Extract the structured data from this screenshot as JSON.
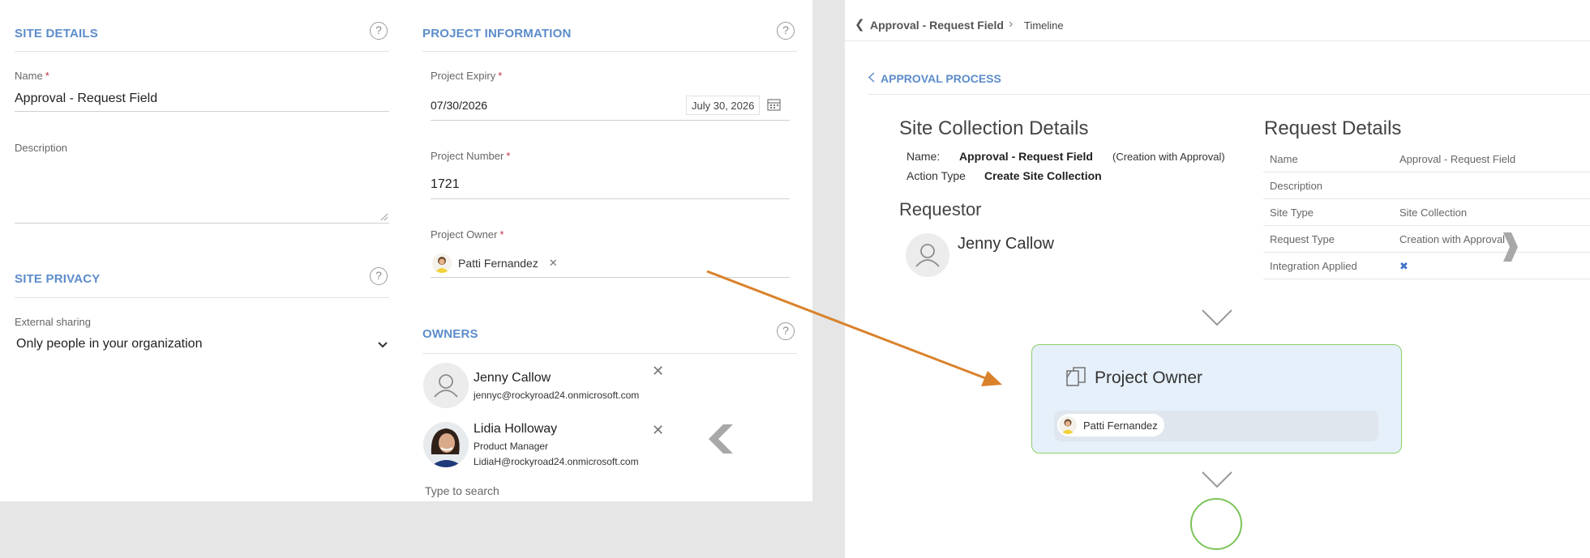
{
  "site_details": {
    "section_title": "SITE DETAILS",
    "name_label": "Name",
    "name_required": "*",
    "name_value": "Approval - Request Field",
    "description_label": "Description",
    "description_value": ""
  },
  "site_privacy": {
    "section_title": "SITE PRIVACY",
    "external_sharing_label": "External sharing",
    "external_sharing_value": "Only people in your organization"
  },
  "project_information": {
    "section_title": "PROJECT INFORMATION",
    "expiry_label": "Project Expiry",
    "expiry_value": "07/30/2026",
    "expiry_display": "July 30, 2026",
    "number_label": "Project Number",
    "number_value": "1721",
    "owner_label": "Project Owner",
    "owner_value": "Patti Fernandez",
    "required_marker": "*"
  },
  "owners": {
    "section_title": "OWNERS",
    "people": [
      {
        "name": "Jenny Callow",
        "title": "",
        "email": "jennyc@rockyroad24.onmicrosoft.com"
      },
      {
        "name": "Lidia Holloway",
        "title": "Product Manager",
        "email": "LidiaH@rockyroad24.onmicrosoft.com"
      }
    ],
    "search_placeholder": "Type to search"
  },
  "help_glyph": "?",
  "remove_glyph": "✕",
  "right": {
    "breadcrumb": {
      "back_glyph": "❮",
      "item": "Approval - Request Field",
      "separator": "›",
      "current": "Timeline"
    },
    "approval_link": "APPROVAL PROCESS",
    "site_collection": {
      "title": "Site Collection Details",
      "name_key": "Name:",
      "name_value": "Approval - Request Field",
      "name_note": "(Creation with Approval)",
      "action_key": "Action Type",
      "action_value": "Create Site Collection"
    },
    "requestor": {
      "title": "Requestor",
      "name": "Jenny Callow"
    },
    "request_details": {
      "title": "Request Details",
      "rows": [
        {
          "key": "Name",
          "value": "Approval - Request Field"
        },
        {
          "key": "Description",
          "value": ""
        },
        {
          "key": "Site Type",
          "value": "Site Collection"
        },
        {
          "key": "Request Type",
          "value": "Creation with Approval"
        },
        {
          "key": "Integration Applied",
          "value": "✖"
        }
      ]
    },
    "approval_step": {
      "title": "Project Owner",
      "approver": "Patti Fernandez"
    }
  },
  "colors": {
    "section_blue": "#5c8ccb",
    "arrow_orange": "#d9822b",
    "step_fill": "#e6f0fa",
    "step_border": "#8dcf6a",
    "end_circle": "#7cc45a"
  }
}
